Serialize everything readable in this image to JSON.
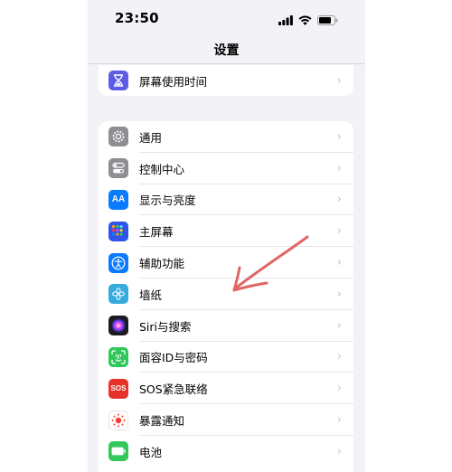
{
  "status": {
    "time": "23:50"
  },
  "nav": {
    "title": "设置"
  },
  "top_item": {
    "label": "屏幕使用时间",
    "icon": "hourglass-icon",
    "color": "#5e5ce6"
  },
  "items": [
    {
      "label": "通用",
      "icon": "gear-icon",
      "color": "#8e8e93"
    },
    {
      "label": "控制中心",
      "icon": "toggles-icon",
      "color": "#8e8e93"
    },
    {
      "label": "显示与亮度",
      "icon": "text-size-icon",
      "color": "#0a7aff"
    },
    {
      "label": "主屏幕",
      "icon": "app-grid-icon",
      "color": "#2f54eb"
    },
    {
      "label": "辅助功能",
      "icon": "accessibility-icon",
      "color": "#0a7aff"
    },
    {
      "label": "墙纸",
      "icon": "flower-icon",
      "color": "#35aadc"
    },
    {
      "label": "Siri与搜索",
      "icon": "siri-icon",
      "color": "#222222"
    },
    {
      "label": "面容ID与密码",
      "icon": "face-id-icon",
      "color": "#30c85a"
    },
    {
      "label": "SOS紧急联络",
      "icon": "sos-icon",
      "color": "#e5332a"
    },
    {
      "label": "暴露通知",
      "icon": "exposure-icon",
      "color": "#ffffff"
    },
    {
      "label": "电池",
      "icon": "battery-icon",
      "color": "#34c759"
    }
  ],
  "annotation": {
    "color": "#e06666"
  }
}
